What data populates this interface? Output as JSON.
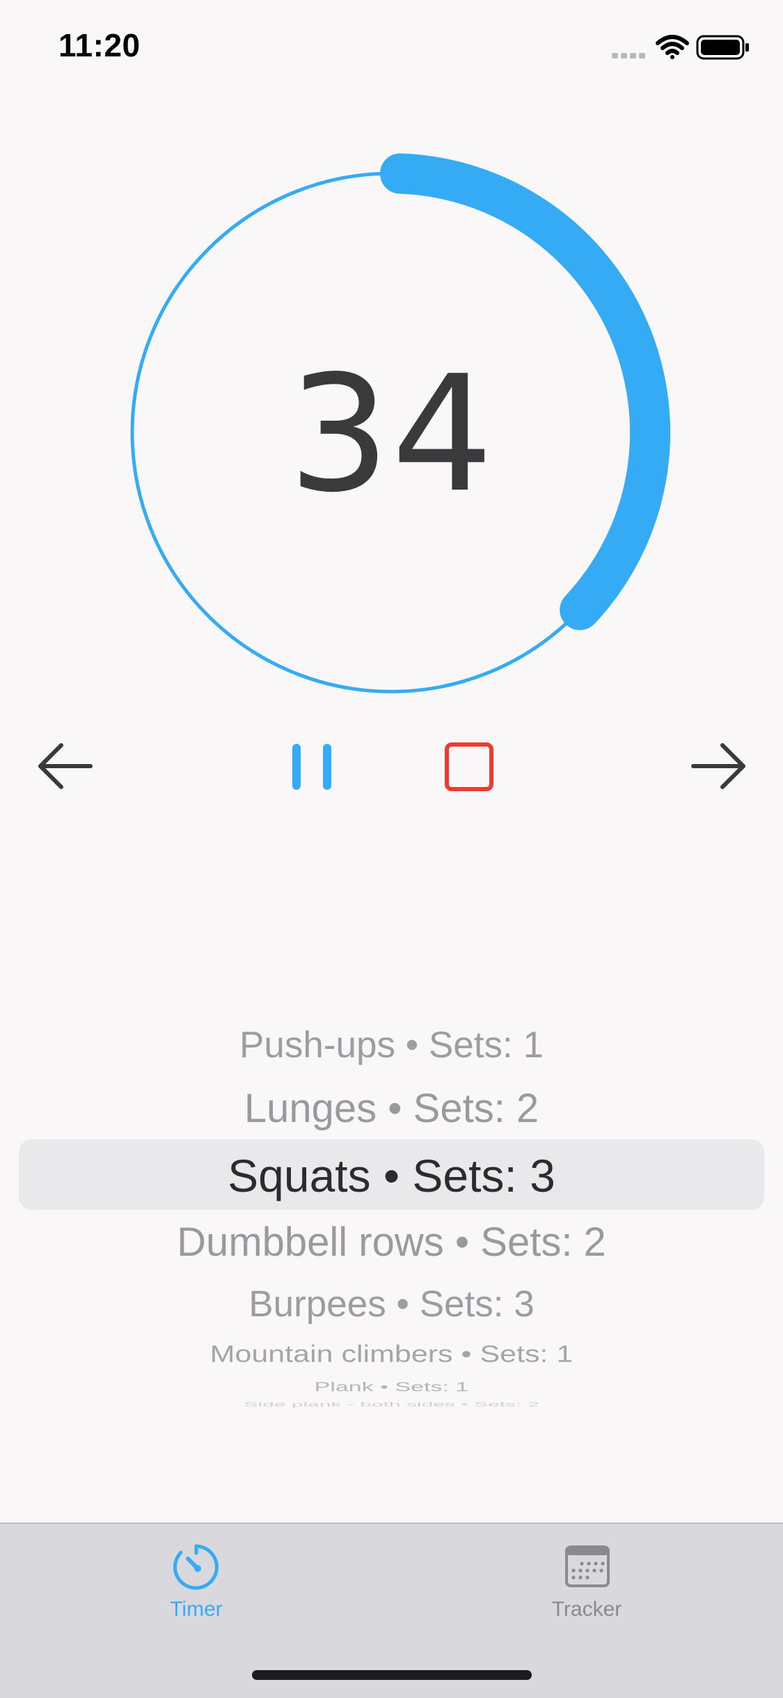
{
  "status_bar": {
    "time": "11:20",
    "icons": [
      "cellular-signal-icon",
      "wifi-icon",
      "battery-icon"
    ]
  },
  "timer": {
    "remaining": "34",
    "progress_fraction": 0.37,
    "accent_color": "#35abf5",
    "text_color": "#3a3a3c"
  },
  "controls": {
    "previous_icon": "arrow-left-icon",
    "pause_icon": "pause-icon",
    "stop_icon": "stop-icon",
    "next_icon": "arrow-right-icon",
    "stop_color": "#ee3a30"
  },
  "exercise_picker": {
    "selected_index": 2,
    "items": [
      {
        "label": "Push-ups • Sets: 1"
      },
      {
        "label": "Lunges • Sets: 2"
      },
      {
        "label": "Squats • Sets: 3"
      },
      {
        "label": "Dumbbell rows • Sets: 2"
      },
      {
        "label": "Burpees • Sets: 3"
      },
      {
        "label": "Mountain climbers • Sets: 1"
      },
      {
        "label": "Plank • Sets: 1"
      },
      {
        "label": "Side plank - both sides • Sets: 2"
      }
    ]
  },
  "tab_bar": {
    "tabs": [
      {
        "label": "Timer",
        "icon": "stopwatch-icon",
        "active": true
      },
      {
        "label": "Tracker",
        "icon": "calendar-icon",
        "active": false
      }
    ],
    "active_color": "#35abf5",
    "inactive_color": "#8a8a8e"
  }
}
